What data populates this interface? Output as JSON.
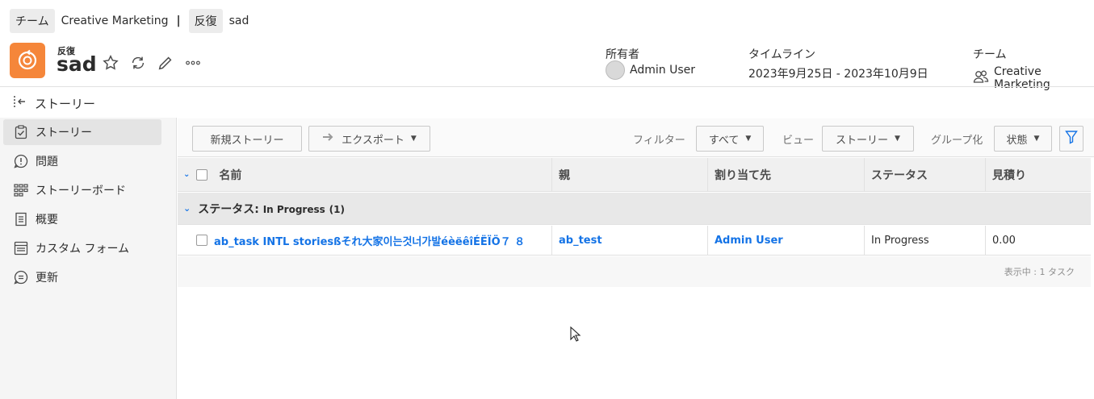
{
  "breadcrumb": {
    "team_label": "チーム",
    "team_name": "Creative Marketing",
    "separator": "|",
    "iteration_label": "反復",
    "iteration_name": "sad"
  },
  "header": {
    "object_type": "反復",
    "title": "sad",
    "icon": "iteration-icon",
    "icon_color": "#f5863a",
    "owner_label": "所有者",
    "owner_name": "Admin User",
    "timeline_label": "タイムライン",
    "timeline_value": "2023年9月25日 - 2023年10月9日",
    "team_label": "チーム",
    "team_value": "Creative Marketing"
  },
  "sidebar": {
    "header": "ストーリー",
    "items": [
      {
        "label": "ストーリー",
        "icon": "story-clipboard-icon",
        "active": true
      },
      {
        "label": "問題",
        "icon": "issue-icon"
      },
      {
        "label": "ストーリーボード",
        "icon": "board-grid-icon"
      },
      {
        "label": "概要",
        "icon": "document-icon"
      },
      {
        "label": "カスタム フォーム",
        "icon": "form-icon"
      },
      {
        "label": "更新",
        "icon": "comment-icon"
      }
    ]
  },
  "toolbar": {
    "new_story": "新規ストーリー",
    "export": "エクスポート",
    "filter_label": "フィルター",
    "filter_value": "すべて",
    "view_label": "ビュー",
    "view_value": "ストーリー",
    "group_label": "グループ化",
    "group_value": "状態"
  },
  "table": {
    "columns": [
      "名前",
      "親",
      "割り当て先",
      "ステータス",
      "見積り"
    ],
    "group": {
      "prefix": "ステータス:",
      "name": "In Progress",
      "count": "(1)"
    },
    "rows": [
      {
        "name": "ab_task INTL storiesßそれ大家이는것너가발éèëêîÉËÏÖ７ ８",
        "parent": "ab_test",
        "assignee": "Admin User",
        "status": "In Progress",
        "estimate": "0.00"
      }
    ],
    "footer": "表示中 : 1 タスク"
  },
  "colors": {
    "accent": "#1473e6",
    "brand_orange": "#f5863a"
  }
}
